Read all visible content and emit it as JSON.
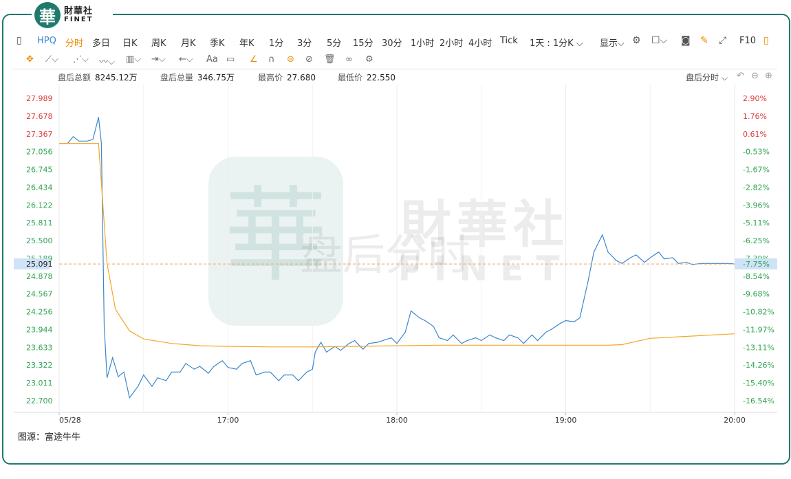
{
  "brand": {
    "logo_char": "華",
    "name_cn": "財華社",
    "name_en": "FINET"
  },
  "toolbar": {
    "symbol": "HPQ",
    "intervals": [
      "分时",
      "多日",
      "日K",
      "周K",
      "月K",
      "季K",
      "年K",
      "1分",
      "3分",
      "5分",
      "15分",
      "30分",
      "1小时",
      "2小时",
      "4小时",
      "Tick",
      "1天 : 1分K"
    ],
    "active_interval": "分时",
    "display_label": "显示",
    "f10_label": "F10",
    "icons_right": [
      "settings-icon",
      "square-dropdown-icon",
      "camera-icon",
      "pencil-icon",
      "fullscreen-icon"
    ]
  },
  "drawing_tools": {
    "icons": [
      "crosshair-move-icon",
      "line-tool-icon",
      "pen-tool-icon",
      "wave-tool-icon",
      "indicator-icon",
      "range-tool-icon",
      "arrow-tool-icon",
      "comment-icon",
      "measure-icon",
      "magnet-icon",
      "eye-icon",
      "hide-icon",
      "trash-icon",
      "link-icon",
      "settings-icon"
    ],
    "text_label": "Aa"
  },
  "stats": [
    {
      "label": "盘后总额",
      "value": "8245.12万"
    },
    {
      "label": "盘后总量",
      "value": "346.75万"
    },
    {
      "label": "最高价",
      "value": "27.680"
    },
    {
      "label": "最低价",
      "value": "22.550"
    }
  ],
  "period_selector": "盘后分时",
  "source": "图源：富途牛牛",
  "watermark": {
    "cn": "財華社",
    "en": "FINET",
    "overlay": "盘后分时"
  },
  "colors": {
    "price_line": "#3a86d1",
    "avg_line": "#f5a623",
    "up_text": "#e03c3c",
    "down_text": "#2ea44f",
    "ref_line": "#f5a05a",
    "current_highlight": "#cfe3f8",
    "brand": "#1f7a6b"
  },
  "chart_data": {
    "type": "line",
    "x_ticks": [
      "05/28",
      "17:00",
      "18:00",
      "19:00",
      "20:00"
    ],
    "x_range": [
      "16:00",
      "20:00"
    ],
    "y_left_ticks": [
      "27.989",
      "27.678",
      "27.367",
      "27.056",
      "26.745",
      "26.434",
      "26.122",
      "25.811",
      "25.500",
      "25.189",
      "24.878",
      "24.567",
      "24.256",
      "23.944",
      "23.633",
      "23.322",
      "23.011",
      "22.700"
    ],
    "y_right_ticks": [
      "2.90%",
      "1.76%",
      "0.61%",
      "-0.53%",
      "-1.67%",
      "-2.82%",
      "-3.96%",
      "-5.11%",
      "-6.25%",
      "-7.39%",
      "-8.54%",
      "-9.68%",
      "-10.82%",
      "-11.97%",
      "-13.11%",
      "-14.26%",
      "-15.40%",
      "-16.54%"
    ],
    "ylim": [
      22.7,
      27.989
    ],
    "reference_price": 27.2,
    "current_price_label": "25.091",
    "current_pct_label": "-7.75%",
    "current_price": 25.091,
    "series": [
      {
        "name": "价格",
        "x": [
          "16:00",
          "16:03",
          "16:05",
          "16:07",
          "16:10",
          "16:12",
          "16:14",
          "16:15",
          "16:16",
          "16:17",
          "16:19",
          "16:21",
          "16:23",
          "16:25",
          "16:28",
          "16:30",
          "16:33",
          "16:35",
          "16:38",
          "16:40",
          "16:43",
          "16:45",
          "16:48",
          "16:50",
          "16:53",
          "16:55",
          "16:58",
          "17:00",
          "17:03",
          "17:05",
          "17:08",
          "17:10",
          "17:13",
          "17:15",
          "17:18",
          "17:20",
          "17:23",
          "17:25",
          "17:28",
          "17:30",
          "17:31",
          "17:33",
          "17:35",
          "17:38",
          "17:40",
          "17:43",
          "17:45",
          "17:48",
          "17:50",
          "17:53",
          "17:55",
          "17:58",
          "18:00",
          "18:03",
          "18:05",
          "18:08",
          "18:10",
          "18:13",
          "18:15",
          "18:18",
          "18:20",
          "18:23",
          "18:25",
          "18:28",
          "18:30",
          "18:33",
          "18:35",
          "18:38",
          "18:40",
          "18:43",
          "18:45",
          "18:48",
          "18:50",
          "18:53",
          "18:55",
          "18:58",
          "19:00",
          "19:03",
          "19:05",
          "19:08",
          "19:10",
          "19:13",
          "19:15",
          "19:18",
          "19:20",
          "19:23",
          "19:25",
          "19:28",
          "19:30",
          "19:33",
          "19:35",
          "19:38",
          "19:40",
          "19:43",
          "19:45",
          "19:48",
          "19:50",
          "19:53",
          "19:55",
          "19:58",
          "20:00"
        ],
        "values": [
          27.2,
          27.2,
          27.32,
          27.24,
          27.24,
          27.27,
          27.66,
          27.2,
          24.0,
          23.1,
          23.45,
          23.12,
          23.2,
          22.75,
          22.95,
          23.15,
          22.95,
          23.1,
          23.05,
          23.2,
          23.2,
          23.35,
          23.25,
          23.3,
          23.18,
          23.3,
          23.4,
          23.28,
          23.25,
          23.35,
          23.4,
          23.15,
          23.2,
          23.2,
          23.05,
          23.15,
          23.15,
          23.05,
          23.2,
          23.25,
          23.55,
          23.72,
          23.55,
          23.65,
          23.58,
          23.7,
          23.75,
          23.6,
          23.7,
          23.72,
          23.75,
          23.8,
          23.7,
          23.9,
          24.27,
          24.15,
          24.1,
          24.0,
          23.8,
          23.75,
          23.85,
          23.7,
          23.75,
          23.8,
          23.75,
          23.85,
          23.8,
          23.75,
          23.85,
          23.8,
          23.7,
          23.85,
          23.75,
          23.9,
          23.95,
          24.05,
          24.1,
          24.08,
          24.15,
          24.8,
          25.3,
          25.6,
          25.3,
          25.15,
          25.1,
          25.2,
          25.25,
          25.12,
          25.2,
          25.3,
          25.18,
          25.2,
          25.1,
          25.12,
          25.08,
          25.1,
          25.1,
          25.1,
          25.1,
          25.1,
          25.091
        ]
      },
      {
        "name": "均价",
        "x": [
          "16:00",
          "16:14",
          "16:15",
          "16:17",
          "16:20",
          "16:25",
          "16:30",
          "16:40",
          "16:50",
          "17:00",
          "17:15",
          "17:30",
          "17:45",
          "18:00",
          "18:15",
          "18:30",
          "18:45",
          "19:00",
          "19:15",
          "19:20",
          "19:30",
          "19:45",
          "20:00"
        ],
        "values": [
          27.2,
          27.2,
          26.5,
          25.1,
          24.3,
          23.92,
          23.78,
          23.7,
          23.66,
          23.65,
          23.64,
          23.64,
          23.65,
          23.66,
          23.67,
          23.67,
          23.67,
          23.67,
          23.67,
          23.68,
          23.79,
          23.83,
          23.87
        ]
      }
    ]
  }
}
